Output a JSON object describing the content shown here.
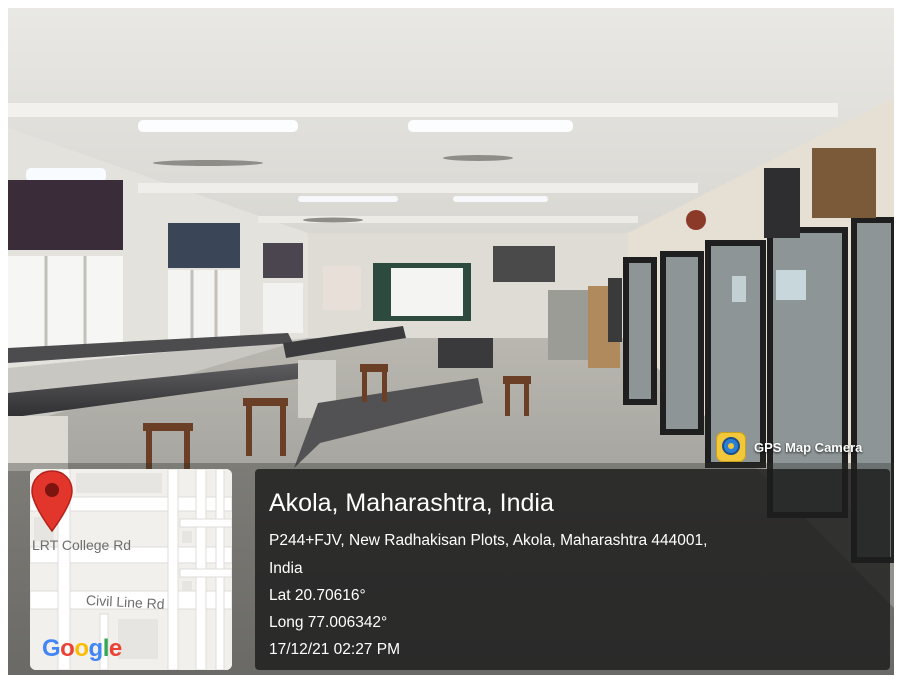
{
  "badge": {
    "label": "GPS Map Camera",
    "icon": "gps-map-camera-app-icon"
  },
  "map": {
    "labels": {
      "college": "LRT College Rd",
      "road": "Civil Line Rd"
    },
    "brand": "Google",
    "brand_colors": [
      "#4285F4",
      "#EA4335",
      "#FBBC05",
      "#4285F4",
      "#34A853",
      "#EA4335"
    ],
    "pin_color": "#e2352b"
  },
  "location": {
    "place": "Akola, Maharashtra, India",
    "address_line1": "P244+FJV, New Radhakisan Plots, Akola, Maharashtra 444001,",
    "address_line2": "India",
    "latitude": "Lat 20.70616°",
    "longitude": "Long 77.006342°",
    "datetime": "17/12/21 02:27 PM"
  }
}
